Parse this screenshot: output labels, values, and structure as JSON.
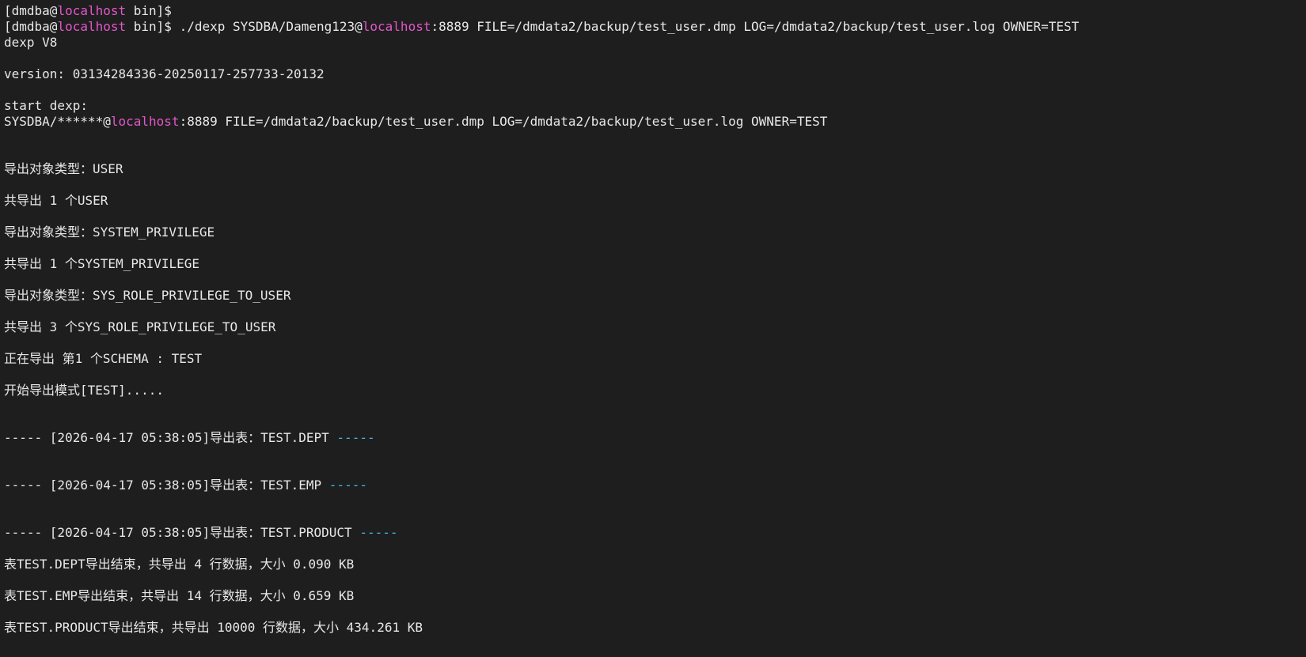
{
  "colors": {
    "background": "#1e1e1e",
    "foreground": "#e8e8e8",
    "host_highlight": "#e356c9",
    "dash_highlight": "#41b8e8"
  },
  "prompt": {
    "open": "[dmdba@",
    "host": "localhost",
    "close": " bin]$"
  },
  "command": {
    "prefix": " ./dexp SYSDBA/Dameng123@",
    "host": "localhost",
    "suffix": ":8889 FILE=/dmdata2/backup/test_user.dmp LOG=/dmdata2/backup/test_user.log OWNER=TEST"
  },
  "output": {
    "product": "dexp V8",
    "version": "version: 03134284336-20250117-257733-20132",
    "start": "start dexp:",
    "conn_prefix": "SYSDBA/******@",
    "conn_host": "localhost",
    "conn_suffix": ":8889 FILE=/dmdata2/backup/test_user.dmp LOG=/dmdata2/backup/test_user.log OWNER=TEST",
    "messages": [
      "导出对象类型：USER",
      "共导出 1 个USER",
      "导出对象类型：SYSTEM_PRIVILEGE",
      "共导出 1 个SYSTEM_PRIVILEGE",
      "导出对象类型：SYS_ROLE_PRIVILEGE_TO_USER",
      "共导出 3 个SYS_ROLE_PRIVILEGE_TO_USER",
      "正在导出 第1 个SCHEMA : TEST",
      "开始导出模式[TEST]....."
    ],
    "tables": [
      {
        "head": "----- [2026-04-17 05:38:05]导出表：TEST.DEPT ",
        "tail": "-----"
      },
      {
        "head": "----- [2026-04-17 05:38:05]导出表：TEST.EMP ",
        "tail": "-----"
      },
      {
        "head": "----- [2026-04-17 05:38:05]导出表：TEST.PRODUCT ",
        "tail": "-----"
      }
    ],
    "results": [
      "表TEST.DEPT导出结束，共导出 4 行数据，大小 0.090 KB",
      "表TEST.EMP导出结束，共导出 14 行数据，大小 0.659 KB",
      "表TEST.PRODUCT导出结束，共导出 10000 行数据，大小 434.261 KB"
    ]
  }
}
